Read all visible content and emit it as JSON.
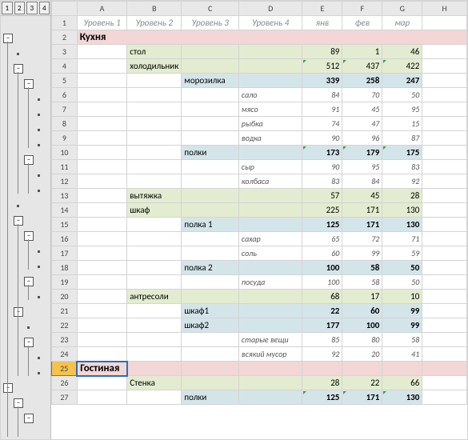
{
  "outline_levels": [
    "1",
    "2",
    "3",
    "4"
  ],
  "col_headers": [
    "",
    "A",
    "B",
    "C",
    "D",
    "E",
    "F",
    "G",
    "H"
  ],
  "header_row": {
    "row": "1",
    "a": "Уровень 1",
    "b": "Уровень 2",
    "c": "Уровень 3",
    "d": "Уровень 4",
    "e": "янв",
    "f": "фев",
    "g": "мар"
  },
  "selected_row": "25",
  "rows": [
    {
      "r": "2",
      "type": "sec",
      "a": "Кухня"
    },
    {
      "r": "3",
      "type": "l2",
      "b": "стол",
      "e": "89",
      "f": "1",
      "g": "46"
    },
    {
      "r": "4",
      "type": "l2",
      "b": "холодильник",
      "e": "512",
      "f": "437",
      "g": "422",
      "tri": true
    },
    {
      "r": "5",
      "type": "l3",
      "c": "морозилка",
      "e": "339",
      "f": "258",
      "g": "247",
      "bold": true
    },
    {
      "r": "6",
      "type": "l4",
      "d": "сало",
      "e": "84",
      "f": "70",
      "g": "50"
    },
    {
      "r": "7",
      "type": "l4",
      "d": "мясо",
      "e": "91",
      "f": "45",
      "g": "95"
    },
    {
      "r": "8",
      "type": "l4",
      "d": "рыбка",
      "e": "74",
      "f": "47",
      "g": "15"
    },
    {
      "r": "9",
      "type": "l4",
      "d": "водка",
      "e": "90",
      "f": "96",
      "g": "87"
    },
    {
      "r": "10",
      "type": "l3",
      "c": "полки",
      "e": "173",
      "f": "179",
      "g": "175",
      "bold": true,
      "tri": true
    },
    {
      "r": "11",
      "type": "l4",
      "d": "сыр",
      "e": "90",
      "f": "95",
      "g": "83"
    },
    {
      "r": "12",
      "type": "l4",
      "d": "колбаса",
      "e": "83",
      "f": "84",
      "g": "92"
    },
    {
      "r": "13",
      "type": "l2",
      "b": "вытяжка",
      "e": "57",
      "f": "45",
      "g": "28"
    },
    {
      "r": "14",
      "type": "l2",
      "b": "шкаф",
      "e": "225",
      "f": "171",
      "g": "130"
    },
    {
      "r": "15",
      "type": "l3",
      "c": "полка 1",
      "e": "125",
      "f": "171",
      "g": "130",
      "bold": true
    },
    {
      "r": "16",
      "type": "l4",
      "d": "сахар",
      "e": "65",
      "f": "72",
      "g": "71"
    },
    {
      "r": "17",
      "type": "l4",
      "d": "соль",
      "e": "60",
      "f": "99",
      "g": "59"
    },
    {
      "r": "18",
      "type": "l3",
      "c": "полка 2",
      "e": "100",
      "f": "58",
      "g": "50",
      "bold": true
    },
    {
      "r": "19",
      "type": "l4",
      "d": "посуда",
      "e": "100",
      "f": "58",
      "g": "50"
    },
    {
      "r": "20",
      "type": "l2",
      "b": "антресоли",
      "e": "68",
      "f": "17",
      "g": "10"
    },
    {
      "r": "21",
      "type": "l3",
      "c": "шкаф1",
      "e": "22",
      "f": "60",
      "g": "99",
      "bold": true
    },
    {
      "r": "22",
      "type": "l3",
      "c": "шкаф2",
      "e": "177",
      "f": "100",
      "g": "99",
      "bold": true
    },
    {
      "r": "23",
      "type": "l4",
      "d": "старые вещи",
      "e": "85",
      "f": "80",
      "g": "58"
    },
    {
      "r": "24",
      "type": "l4",
      "d": "всякий мусор",
      "e": "92",
      "f": "20",
      "g": "41"
    },
    {
      "r": "25",
      "type": "sec",
      "a": "Гостиная"
    },
    {
      "r": "26",
      "type": "l2",
      "b": "Стенка",
      "e": "28",
      "f": "22",
      "g": "66"
    },
    {
      "r": "27",
      "type": "l3",
      "c": "полки",
      "e": "125",
      "f": "171",
      "g": "130",
      "bold": true,
      "tri": true
    }
  ],
  "outline_nodes": [
    {
      "row": 0,
      "lvl": 1,
      "sym": "−"
    },
    {
      "row": 1,
      "lvl": 2,
      "sym": "·"
    },
    {
      "row": 2,
      "lvl": 2,
      "sym": "−"
    },
    {
      "row": 3,
      "lvl": 3,
      "sym": "−"
    },
    {
      "row": 4,
      "lvl": 4,
      "sym": "·"
    },
    {
      "row": 5,
      "lvl": 4,
      "sym": "·"
    },
    {
      "row": 6,
      "lvl": 4,
      "sym": "·"
    },
    {
      "row": 7,
      "lvl": 4,
      "sym": "·"
    },
    {
      "row": 8,
      "lvl": 3,
      "sym": "−"
    },
    {
      "row": 9,
      "lvl": 4,
      "sym": "·"
    },
    {
      "row": 10,
      "lvl": 4,
      "sym": "·"
    },
    {
      "row": 11,
      "lvl": 2,
      "sym": "·"
    },
    {
      "row": 12,
      "lvl": 2,
      "sym": "−"
    },
    {
      "row": 13,
      "lvl": 3,
      "sym": "−"
    },
    {
      "row": 14,
      "lvl": 4,
      "sym": "·"
    },
    {
      "row": 15,
      "lvl": 4,
      "sym": "·"
    },
    {
      "row": 16,
      "lvl": 3,
      "sym": "−"
    },
    {
      "row": 17,
      "lvl": 4,
      "sym": "·"
    },
    {
      "row": 18,
      "lvl": 2,
      "sym": "−"
    },
    {
      "row": 19,
      "lvl": 3,
      "sym": "·"
    },
    {
      "row": 20,
      "lvl": 3,
      "sym": "−"
    },
    {
      "row": 21,
      "lvl": 4,
      "sym": "·"
    },
    {
      "row": 22,
      "lvl": 4,
      "sym": "·"
    },
    {
      "row": 23,
      "lvl": 1,
      "sym": "−"
    },
    {
      "row": 24,
      "lvl": 2,
      "sym": "−"
    },
    {
      "row": 25,
      "lvl": 3,
      "sym": "−"
    }
  ]
}
